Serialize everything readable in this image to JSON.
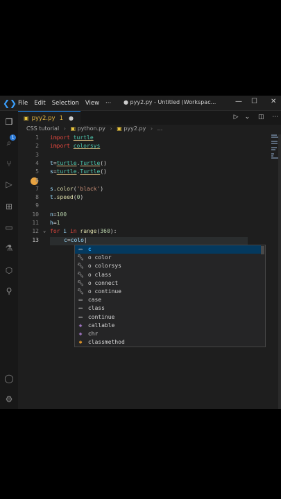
{
  "menu": {
    "file": "File",
    "edit": "Edit",
    "selection": "Selection",
    "view": "View",
    "more": "···"
  },
  "window_title": "● pyy2.py - Untitled (Workspac...",
  "tab": {
    "label": "pyy2.py",
    "modified": "1",
    "dirty_dot": "●"
  },
  "breadcrumb": {
    "folder": "CSS tutorial",
    "file1": "python.py",
    "file2": "pyy2.py",
    "tail": "..."
  },
  "activity_badge": "1",
  "lines": {
    "l1": [
      "import",
      " ",
      "turtle"
    ],
    "l2": [
      "import",
      " ",
      "colorsys"
    ],
    "l4": [
      "t",
      "=",
      "turtle",
      ".",
      "Turtle",
      "()"
    ],
    "l5": [
      "s",
      "=",
      "turtle",
      ".",
      "Turtle",
      "()"
    ],
    "l7": [
      "s",
      ".",
      "color",
      "(",
      "'black'",
      ")"
    ],
    "l8": [
      "t",
      ".",
      "speed",
      "(",
      "0",
      ")"
    ],
    "l10": [
      "n",
      "=",
      "100"
    ],
    "l11": [
      "h",
      "=",
      "1"
    ],
    "l12": [
      "for",
      " ",
      "i",
      " ",
      "in",
      " ",
      "range",
      "(",
      "360",
      "):"
    ],
    "l13": [
      "c",
      "=",
      "colo"
    ]
  },
  "line_numbers": [
    "1",
    "2",
    "3",
    "4",
    "5",
    "6",
    "7",
    "8",
    "9",
    "10",
    "11",
    "12",
    "13"
  ],
  "suggestions": [
    {
      "icon": "keyword-icon",
      "label": "c",
      "kind": "text"
    },
    {
      "icon": "wrench-icon",
      "label": "o color",
      "kind": "wrench"
    },
    {
      "icon": "wrench-icon",
      "label": "o colorsys",
      "kind": "wrench"
    },
    {
      "icon": "wrench-icon",
      "label": "o class",
      "kind": "wrench"
    },
    {
      "icon": "wrench-icon",
      "label": "o connect",
      "kind": "wrench"
    },
    {
      "icon": "wrench-icon",
      "label": "o continue",
      "kind": "wrench"
    },
    {
      "icon": "keyword-icon",
      "label": "case",
      "kind": "kw"
    },
    {
      "icon": "keyword-icon",
      "label": "class",
      "kind": "kw"
    },
    {
      "icon": "keyword-icon",
      "label": "continue",
      "kind": "kw"
    },
    {
      "icon": "cube-icon",
      "label": "callable",
      "kind": "cube"
    },
    {
      "icon": "cube-icon",
      "label": "chr",
      "kind": "cube"
    },
    {
      "icon": "class-icon",
      "label": "classmethod",
      "kind": "class"
    }
  ]
}
